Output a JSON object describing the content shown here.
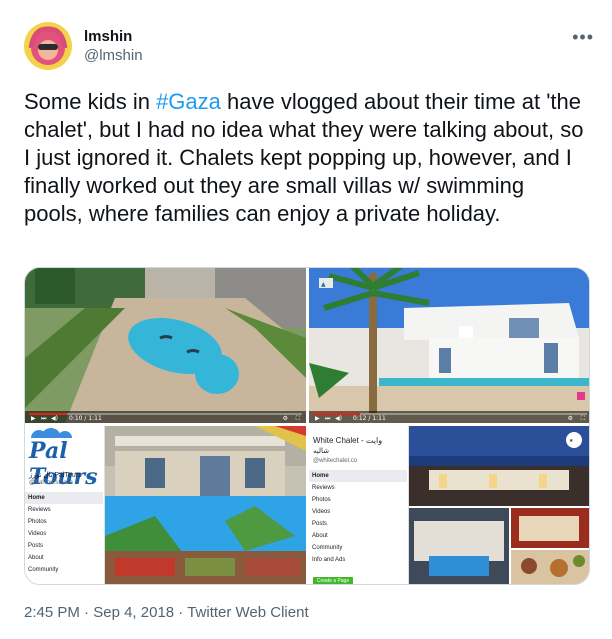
{
  "author": {
    "display_name": "lmshin",
    "handle": "@lmshin"
  },
  "more_icon": "more-horizontal-icon",
  "tweet": {
    "text_before": "Some kids in ",
    "hashtag": "#Gaza",
    "text_after": " have vlogged about their time at 'the chalet', but I had no idea what they were talking about, so I just ignored it. Chalets kept popping up, however, and I finally worked out they are small villas w/ swimming pools, where families can enjoy a private holiday."
  },
  "media": {
    "video1": {
      "time": "0:10 / 1:11",
      "progress": 0.14
    },
    "video2": {
      "time": "0:12 / 1:11",
      "progress": 0.17
    },
    "paltours": {
      "logo": "Pal Tours",
      "name": "بال تورز PalTours",
      "handle": "@PalToursGaza",
      "nav": [
        "Home",
        "Reviews",
        "Photos",
        "Videos",
        "Posts",
        "About",
        "Community"
      ]
    },
    "whitechalet": {
      "title": "White Chalet - وايت",
      "title_ar": "شاليه",
      "handle": "@whitechalet.co",
      "nav": [
        "Home",
        "Reviews",
        "Photos",
        "Videos",
        "Posts",
        "About",
        "Community",
        "Info and Ads"
      ],
      "button": "Create a Page"
    }
  },
  "footer": {
    "time": "2:45 PM",
    "sep1": " · ",
    "date": "Sep 4, 2018",
    "sep2": " · ",
    "client": "Twitter Web Client"
  },
  "colors": {
    "link": "#1d9bf0",
    "text": "#0f1419",
    "secondary": "#536471",
    "border": "#cfd9de"
  }
}
